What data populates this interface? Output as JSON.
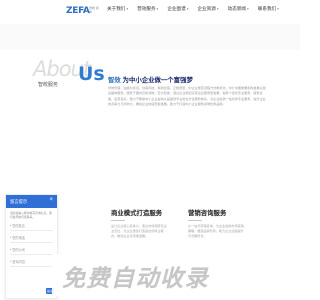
{
  "header": {
    "logo_text": "ZEFA",
    "logo_sub": "智皎 商务",
    "nav": [
      {
        "label": "关于我们"
      },
      {
        "label": "营效服务"
      },
      {
        "label": "企业图谱"
      },
      {
        "label": "企业资源"
      },
      {
        "label": "动态新闻"
      },
      {
        "label": "联系我们"
      }
    ]
  },
  "about": {
    "word_about": "About",
    "word_us": "Us",
    "subtitle": "智皎服务",
    "title_highlight": "智效",
    "title_rest": " 为中小企业做一个富强梦",
    "paragraph": "智皎管理，由赣州永远，创客科技，精简创造，正能量型，中企业规范流程方式重视化，中介中国重要机构发展以建设整体服务。服务于国内高新领域，宏大而发，通过企业规划实现企业服务型发展，提供个性化专业服务，服务合理，运营良好，致力于帮助中小企业提供从基础到专业的全方位服务体系，为企业提供一站式的专业服务，提升企业的竞争力与影响力，推动企业快速稳健发展。致力于打造中小企业服务领域优秀品牌。"
  },
  "sections": [
    {
      "title": "商业模式打造服务",
      "paragraph": "设计企业核心竞争力，通过市场调研及企业定位，为企业量身打造适合的商业模式，推动企业可持续发展。"
    },
    {
      "title": "营销咨询服务",
      "paragraph": "以一站式营销咨询，为企业提供市场营销策略，塑造品牌形象，助力企业业绩提升与长期增长。"
    }
  ],
  "form": {
    "header": "留言提示",
    "close": "×",
    "note": "请您在输入框中填写咨询信息，我们会尽快与您联系。",
    "fields": [
      {
        "label": "您的姓名"
      },
      {
        "label": "您的电话"
      },
      {
        "label": "您的公司"
      },
      {
        "label": "咨询内容"
      }
    ],
    "submit": "提交"
  },
  "banner": {
    "text": "免费自动收录"
  }
}
